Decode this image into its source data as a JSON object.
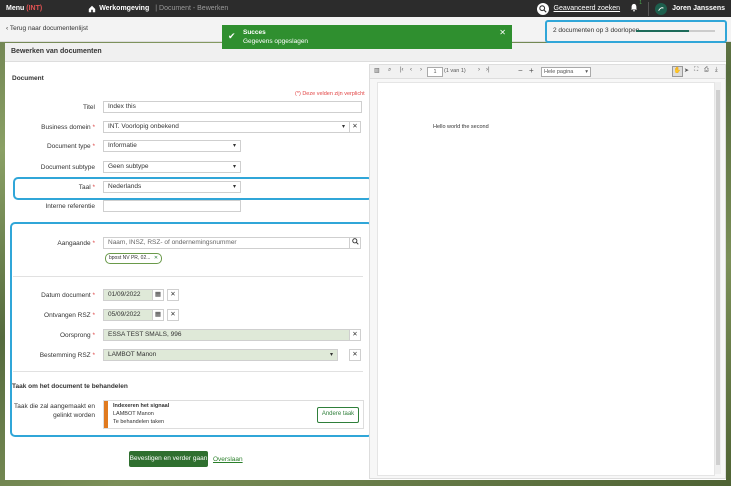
{
  "topbar": {
    "menu_label": "Menu",
    "menu_env": "(INT)",
    "home_label": "Werkomgeving",
    "breadcrumb": "| Document - Bewerken",
    "advanced_search": "Geavanceerd zoeken",
    "notif_count": "1",
    "user": "Joren Janssens"
  },
  "subbar": {
    "back_link": "Terug naar documentenlijst",
    "progress_text": "2 documenten op 3 doorlopen",
    "progress_value": 0.67
  },
  "toast": {
    "title": "Succes",
    "message": "Gegevens opgeslagen"
  },
  "card": {
    "title": "Bewerken van documenten",
    "section_document": "Document",
    "required_note": "(*) Deze velden zijn verplicht",
    "labels": {
      "titel": "Titel",
      "business_domein": "Business domein",
      "document_type": "Document type",
      "document_subtype": "Document subtype",
      "taal": "Taal",
      "interne_referentie": "Interne referentie",
      "aangaande": "Aangaande",
      "datum_document": "Datum document",
      "ontvangen_rsz": "Ontvangen RSZ",
      "oorsprong": "Oorsprong",
      "bestemming_rsz": "Bestemming RSZ",
      "task_label_1": "Taak die zal aangemaakt en",
      "task_label_2": "gelinkt worden"
    },
    "values": {
      "titel": "Index this",
      "business_domein": "INT. Voorlopig onbekend",
      "document_type": "Informatie",
      "document_subtype": "Geen subtype",
      "taal": "Nederlands",
      "interne_referentie": "",
      "aangaande_placeholder": "Naam, INSZ, RSZ- of ondernemingsnummer",
      "aangaande_chip": "bpost NV PR, 02...",
      "datum_document": "01/09/2022",
      "ontvangen_rsz": "05/09/2022",
      "oorsprong": "ESSA TEST SMALS, 996",
      "bestemming_rsz": "LAMBOT Manon"
    },
    "task_section_title": "Taak om het document te behandelen",
    "task": {
      "title": "Indexeren het signaal",
      "assignee": "LAMBOT Manon",
      "status": "Te behandelen taken",
      "other_button": "Andere taak"
    },
    "confirm_button": "Bevestigen en verder gaan",
    "skip_link": "Overslaan"
  },
  "viewer": {
    "page_input": "1",
    "page_count": "(1 van 1)",
    "zoom": "Hele pagina",
    "content": "Hello world the second"
  }
}
